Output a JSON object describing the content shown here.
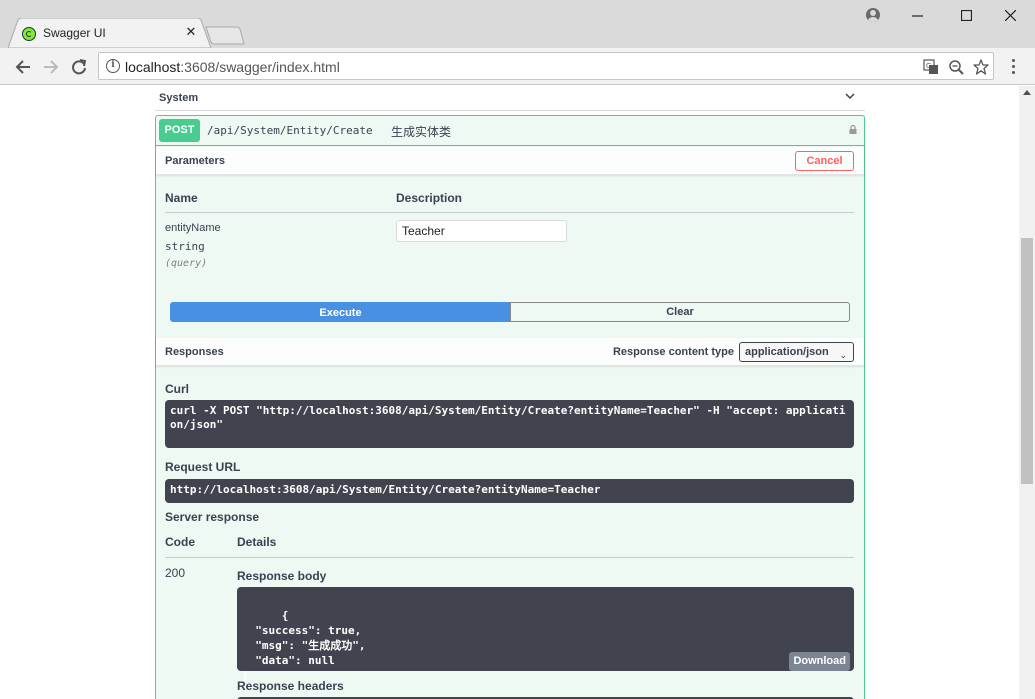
{
  "browser": {
    "tab_title": "Swagger UI",
    "tab_close": "✕",
    "url_host": "localhost",
    "url_rest": ":3608/swagger/index.html"
  },
  "swagger": {
    "tag_name": "System",
    "operation": {
      "method": "POST",
      "path": "/api/System/Entity/Create",
      "description": "生成实体类"
    },
    "parameters": {
      "title": "Parameters",
      "cancel_label": "Cancel",
      "col_name": "Name",
      "col_description": "Description",
      "items": [
        {
          "name": "entityName",
          "type": "string",
          "in": "(query)",
          "value": "Teacher"
        }
      ]
    },
    "execute_label": "Execute",
    "clear_label": "Clear",
    "responses": {
      "title": "Responses",
      "content_type_label": "Response content type",
      "content_type_value": "application/json",
      "curl_label": "Curl",
      "curl": "curl -X POST \"http://localhost:3608/api/System/Entity/Create?entityName=Teacher\" -H \"accept: application/json\"",
      "request_url_label": "Request URL",
      "request_url": "http://localhost:3608/api/System/Entity/Create?entityName=Teacher",
      "server_response_label": "Server response",
      "col_code": "Code",
      "col_details": "Details",
      "code": "200",
      "body_label": "Response body",
      "body": "{\n  \"success\": true,\n  \"msg\": \"生成成功\",\n  \"data\": null\n}",
      "download_label": "Download",
      "headers_label": "Response headers"
    }
  }
}
